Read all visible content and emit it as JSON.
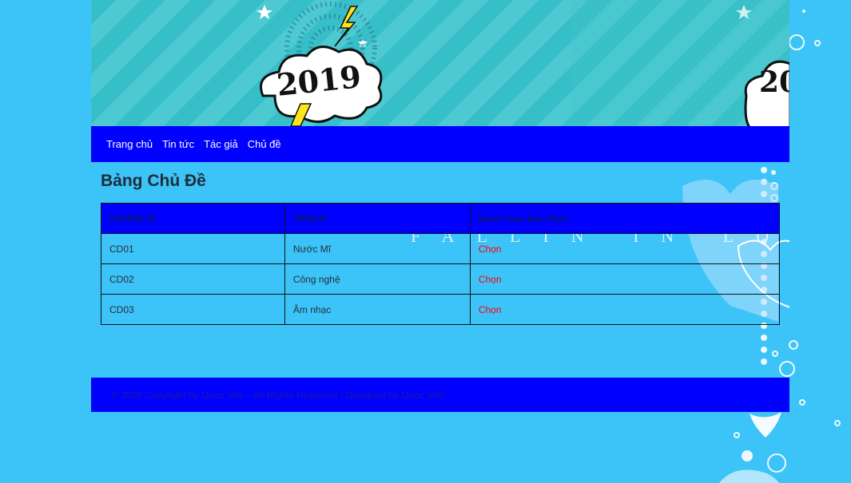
{
  "banner": {
    "year_text": "2019"
  },
  "nav": {
    "items": [
      {
        "label": "Trang chủ"
      },
      {
        "label": "Tin tức"
      },
      {
        "label": "Tác giả"
      },
      {
        "label": "Chủ đề"
      }
    ]
  },
  "main": {
    "title": "Bảng Chủ Đề",
    "decor_text": "FALLIN IN LOVE",
    "table": {
      "headers": [
        "CHUDE ID",
        "TENCD",
        "Danh mục lựa chọn"
      ],
      "rows": [
        {
          "id": "CD01",
          "name": "Nước Mĩ",
          "action": "Chọn"
        },
        {
          "id": "CD02",
          "name": "Công nghệ",
          "action": "Chọn"
        },
        {
          "id": "CD03",
          "name": "Âm nhạc",
          "action": "Chọn"
        }
      ]
    }
  },
  "footer": {
    "text": "© 2020 Copyright by Quoc Viet – All Rights Reserved | Designed by Quoc Viet"
  },
  "colors": {
    "background": "#3cc3f7",
    "nav": "#0000ff",
    "link": "#ff0000"
  }
}
